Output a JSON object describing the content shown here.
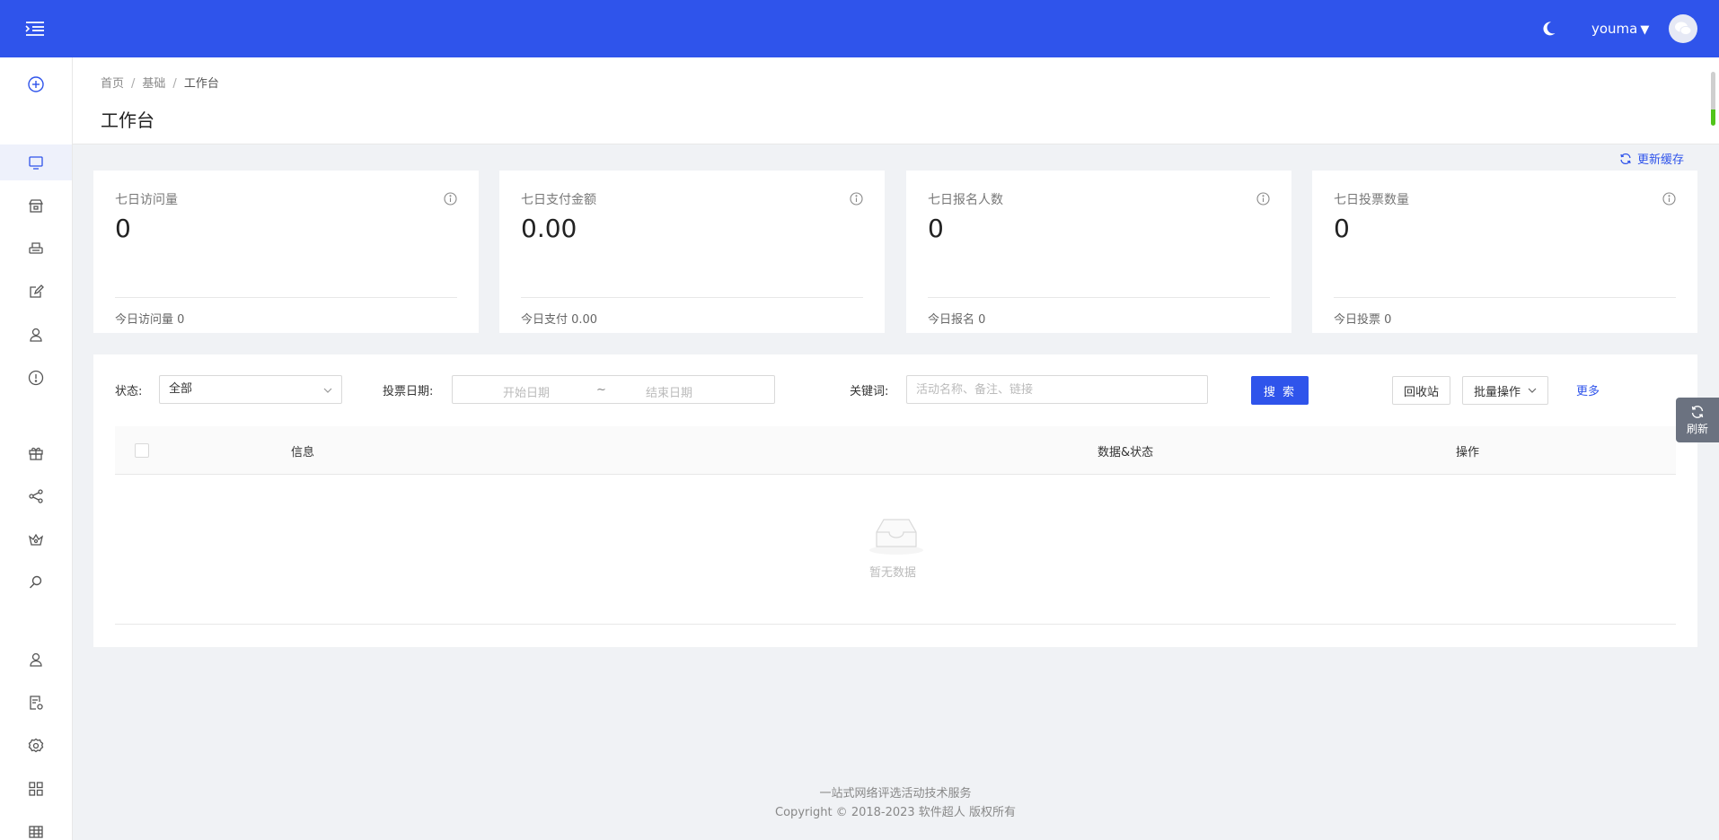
{
  "header": {
    "username": "youma",
    "brand_color": "#2f54eb"
  },
  "breadcrumb": {
    "items": [
      "首页",
      "基础",
      "工作台"
    ],
    "separator": "/"
  },
  "page_title": "工作台",
  "refresh_cache_label": "更新缓存",
  "stats": [
    {
      "label": "七日访问量",
      "value": "0",
      "sub": "今日访问量 0"
    },
    {
      "label": "七日支付金额",
      "value": "0.00",
      "sub": "今日支付 0.00"
    },
    {
      "label": "七日报名人数",
      "value": "0",
      "sub": "今日报名 0"
    },
    {
      "label": "七日投票数量",
      "value": "0",
      "sub": "今日投票 0"
    }
  ],
  "filters": {
    "status_label": "状态:",
    "status_value": "全部",
    "date_label": "投票日期:",
    "date_start_placeholder": "开始日期",
    "date_sep": "~",
    "date_end_placeholder": "结束日期",
    "keyword_label": "关键词:",
    "keyword_placeholder": "活动名称、备注、链接",
    "search_button": "搜 索",
    "recycle_button": "回收站",
    "batch_button": "批量操作",
    "more_link": "更多"
  },
  "table": {
    "columns": [
      "信息",
      "数据&状态",
      "操作"
    ],
    "empty_text": "暂无数据"
  },
  "float_refresh_label": "刷新",
  "footer": {
    "line1": "一站式网络评选活动技术服务",
    "line2": "Copyright © 2018-2023 软件超人 版权所有"
  },
  "sidebar_icons": [
    "add-circle-icon",
    "monitor-icon",
    "shop-icon",
    "printer-icon",
    "edit-icon",
    "user-icon",
    "info-icon",
    "gift-icon",
    "share-icon",
    "crown-icon",
    "search-icon",
    "user-icon",
    "document-settings-icon",
    "settings-icon",
    "apps-icon",
    "table-icon"
  ]
}
